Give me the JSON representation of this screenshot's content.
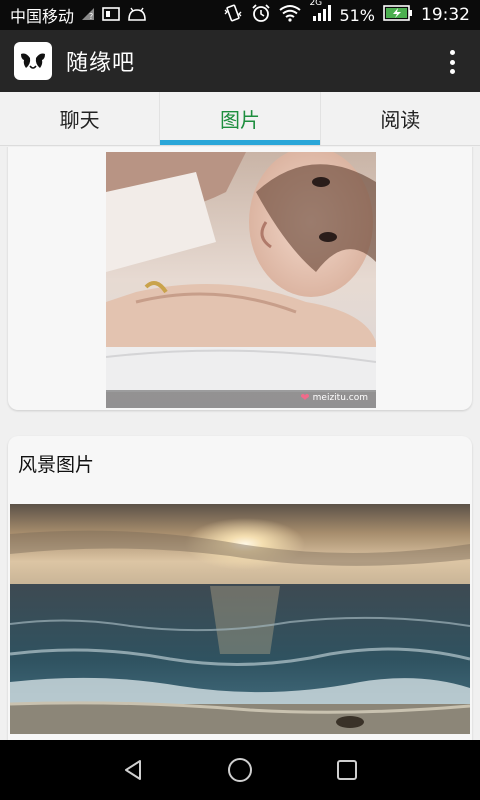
{
  "status_bar": {
    "carrier": "中国移动",
    "network_type": "2G",
    "battery_percent": "51%",
    "time": "19:32",
    "icons": [
      "signal-question-icon",
      "screenshot-icon",
      "android-icon",
      "vibrate-icon",
      "alarm-icon",
      "wifi-icon",
      "cell-signal-icon",
      "battery-charging-icon"
    ]
  },
  "app_bar": {
    "title": "随缘吧",
    "logo_icon": "birds-logo-icon",
    "menu_icon": "overflow-menu-icon"
  },
  "tabs": [
    {
      "label": "聊天",
      "active": false
    },
    {
      "label": "图片",
      "active": true
    },
    {
      "label": "阅读",
      "active": false
    }
  ],
  "colors": {
    "active_tab_text": "#1e8e3e",
    "active_tab_indicator": "#2aa6d8",
    "app_bar_bg": "#262626"
  },
  "feed": [
    {
      "title": "",
      "image_desc": "portrait-photo",
      "watermark": "meizitu.com"
    },
    {
      "title": "风景图片",
      "image_desc": "sunset-sea-photo"
    }
  ],
  "nav_bar": {
    "buttons": [
      "back-icon",
      "home-icon",
      "recents-icon"
    ]
  }
}
